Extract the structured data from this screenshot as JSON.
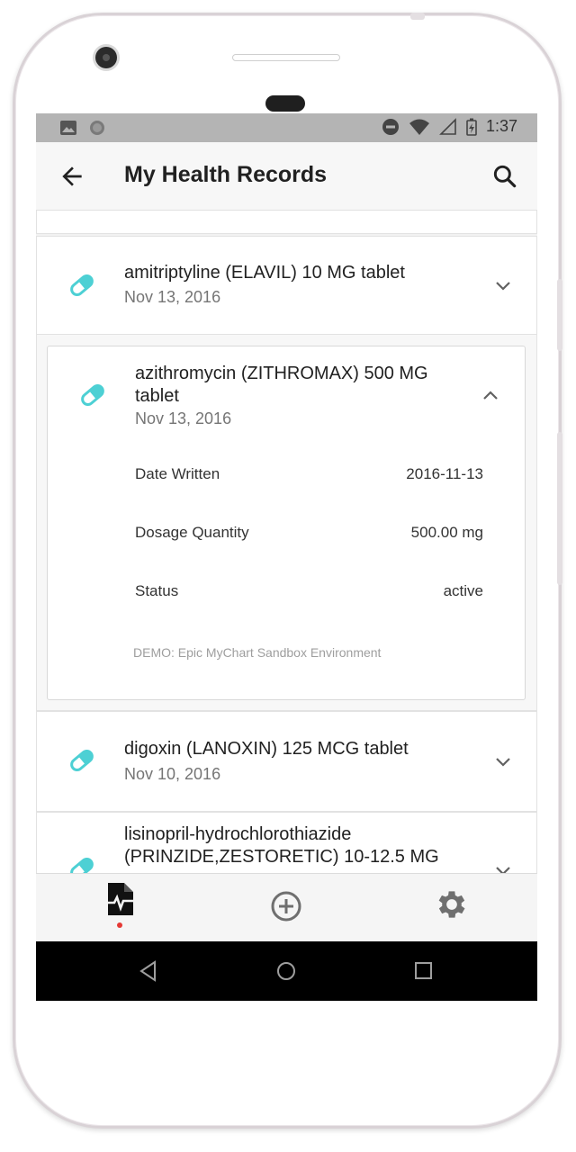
{
  "statusbar": {
    "time": "1:37"
  },
  "appbar": {
    "title": "My Health Records"
  },
  "records": [
    {
      "name": "amitriptyline (ELAVIL) 10 MG tablet",
      "date": "Nov 13, 2016"
    },
    {
      "name": "azithromycin (ZITHROMAX) 500 MG tablet",
      "date": "Nov 13, 2016",
      "details": [
        {
          "label": "Date Written",
          "value": "2016-11-13"
        },
        {
          "label": "Dosage Quantity",
          "value": "500.00 mg"
        },
        {
          "label": "Status",
          "value": "active"
        }
      ],
      "note": "DEMO: Epic MyChart Sandbox Environment"
    },
    {
      "name": "digoxin (LANOXIN) 125 MCG tablet",
      "date": "Nov 10, 2016"
    },
    {
      "name": "lisinopril-hydrochlorothiazide (PRINZIDE,ZESTORETIC) 10-12.5 MG"
    }
  ],
  "icons": {
    "back": "arrow-left-icon",
    "search": "search-icon",
    "medication": "pill-icon",
    "records_tab": "health-record-icon",
    "add_tab": "add-circle-icon",
    "settings_tab": "gear-icon"
  },
  "colors": {
    "pill": "#4dd0d4",
    "active_dot": "#e53935",
    "statusbar": "#b4b4b4"
  }
}
